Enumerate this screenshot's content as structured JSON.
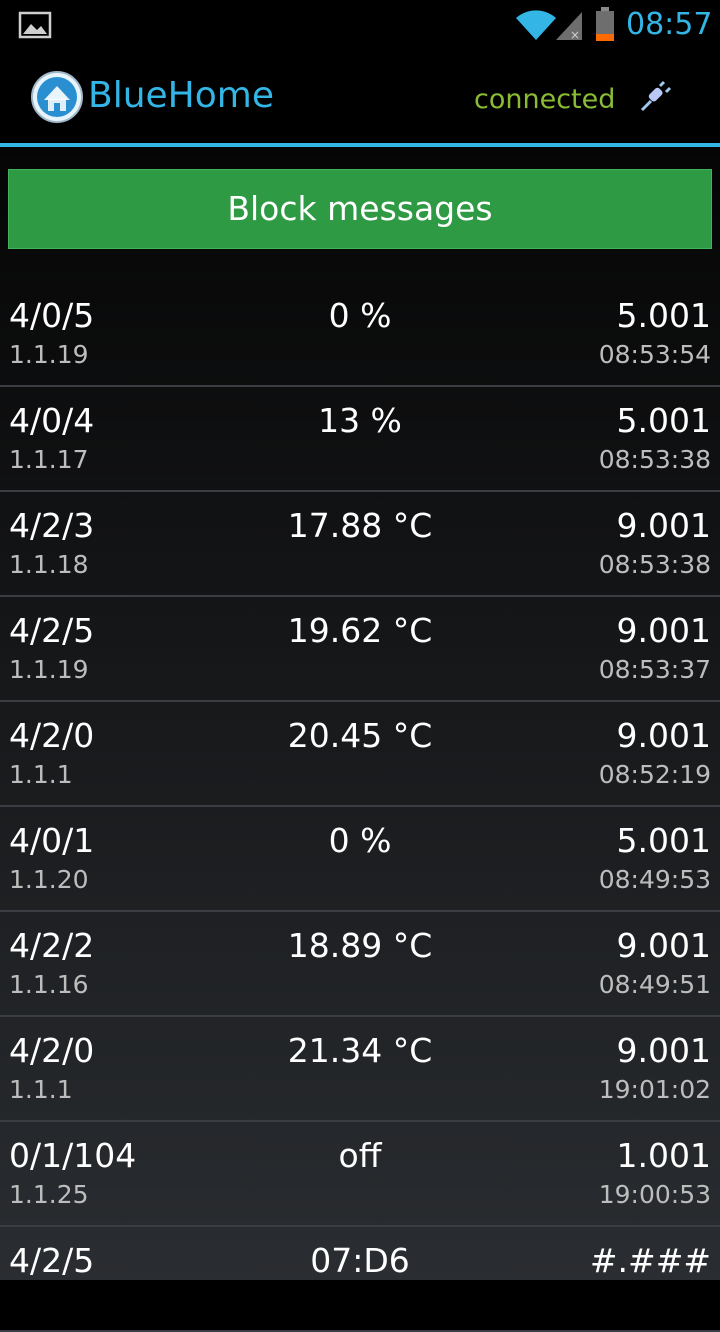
{
  "status_bar": {
    "time": "08:57",
    "icons": [
      "gallery-icon",
      "wifi-icon",
      "signal-icon",
      "battery-icon"
    ],
    "accent": "#33b5e5"
  },
  "action_bar": {
    "title": "BlueHome",
    "connection_status": "connected",
    "icons": [
      "app-logo-icon",
      "plug-icon"
    ],
    "title_color": "#33b5e5",
    "status_color": "#8abb34"
  },
  "block_button": {
    "label": "Block messages",
    "color": "#2e9a44"
  },
  "messages": [
    {
      "address": "4/0/5",
      "source": "1.1.19",
      "value": "0 %",
      "type": "5.001",
      "time": "08:53:54"
    },
    {
      "address": "4/0/4",
      "source": "1.1.17",
      "value": "13 %",
      "type": "5.001",
      "time": "08:53:38"
    },
    {
      "address": "4/2/3",
      "source": "1.1.18",
      "value": "17.88 °C",
      "type": "9.001",
      "time": "08:53:38"
    },
    {
      "address": "4/2/5",
      "source": "1.1.19",
      "value": "19.62 °C",
      "type": "9.001",
      "time": "08:53:37"
    },
    {
      "address": "4/2/0",
      "source": "1.1.1",
      "value": "20.45 °C",
      "type": "9.001",
      "time": "08:52:19"
    },
    {
      "address": "4/0/1",
      "source": "1.1.20",
      "value": "0 %",
      "type": "5.001",
      "time": "08:49:53"
    },
    {
      "address": "4/2/2",
      "source": "1.1.16",
      "value": "18.89 °C",
      "type": "9.001",
      "time": "08:49:51"
    },
    {
      "address": "4/2/0",
      "source": "1.1.1",
      "value": "21.34 °C",
      "type": "9.001",
      "time": "19:01:02"
    },
    {
      "address": "0/1/104",
      "source": "1.1.25",
      "value": "off",
      "type": "1.001",
      "time": "19:00:53"
    },
    {
      "address": "4/2/5",
      "source": "",
      "value": "07:D6",
      "type": "#.###",
      "time": ""
    }
  ]
}
